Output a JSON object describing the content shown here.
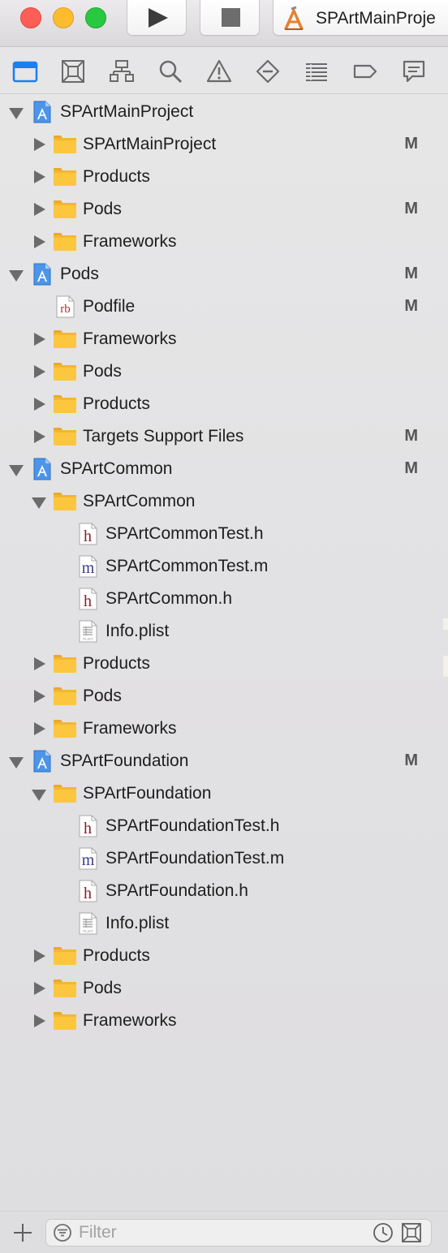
{
  "window": {
    "scheme_label": "SPArtMainProje"
  },
  "toolbar": {
    "run_icon": "play-icon",
    "stop_icon": "stop-icon"
  },
  "navigator_tabs": [
    {
      "name": "project-navigator-tab",
      "icon": "folder-icon",
      "active": true
    },
    {
      "name": "source-control-navigator-tab",
      "icon": "source-control-icon",
      "active": false
    },
    {
      "name": "symbol-navigator-tab",
      "icon": "hierarchy-icon",
      "active": false
    },
    {
      "name": "find-navigator-tab",
      "icon": "magnifier-icon",
      "active": false
    },
    {
      "name": "issue-navigator-tab",
      "icon": "warning-icon",
      "active": false
    },
    {
      "name": "test-navigator-tab",
      "icon": "diamond-icon",
      "active": false
    },
    {
      "name": "debug-navigator-tab",
      "icon": "list-icon",
      "active": false
    },
    {
      "name": "breakpoint-navigator-tab",
      "icon": "tag-icon",
      "active": false
    },
    {
      "name": "report-navigator-tab",
      "icon": "speech-bubble-icon",
      "active": false
    }
  ],
  "tree": [
    {
      "label": "SPArtMainProject",
      "icon": "project",
      "level": 0,
      "state": "expanded",
      "badge": ""
    },
    {
      "label": "SPArtMainProject",
      "icon": "folder",
      "level": 1,
      "state": "collapsed",
      "badge": "M"
    },
    {
      "label": "Products",
      "icon": "folder",
      "level": 1,
      "state": "collapsed",
      "badge": ""
    },
    {
      "label": "Pods",
      "icon": "folder",
      "level": 1,
      "state": "collapsed",
      "badge": "M"
    },
    {
      "label": "Frameworks",
      "icon": "folder",
      "level": 1,
      "state": "collapsed",
      "badge": ""
    },
    {
      "label": "Pods",
      "icon": "project",
      "level": 0,
      "state": "expanded",
      "badge": "M"
    },
    {
      "label": "Podfile",
      "icon": "ruby",
      "level": 1,
      "state": "none",
      "badge": "M"
    },
    {
      "label": "Frameworks",
      "icon": "folder",
      "level": 1,
      "state": "collapsed",
      "badge": ""
    },
    {
      "label": "Pods",
      "icon": "folder",
      "level": 1,
      "state": "collapsed",
      "badge": ""
    },
    {
      "label": "Products",
      "icon": "folder",
      "level": 1,
      "state": "collapsed",
      "badge": ""
    },
    {
      "label": "Targets Support Files",
      "icon": "folder",
      "level": 1,
      "state": "collapsed",
      "badge": "M"
    },
    {
      "label": "SPArtCommon",
      "icon": "project",
      "level": 0,
      "state": "expanded",
      "badge": "M"
    },
    {
      "label": "SPArtCommon",
      "icon": "folder",
      "level": 1,
      "state": "expanded",
      "badge": ""
    },
    {
      "label": "SPArtCommonTest.h",
      "icon": "header",
      "level": 2,
      "state": "none",
      "badge": ""
    },
    {
      "label": "SPArtCommonTest.m",
      "icon": "implementation",
      "level": 2,
      "state": "none",
      "badge": ""
    },
    {
      "label": "SPArtCommon.h",
      "icon": "header",
      "level": 2,
      "state": "none",
      "badge": ""
    },
    {
      "label": "Info.plist",
      "icon": "plist",
      "level": 2,
      "state": "none",
      "badge": ""
    },
    {
      "label": "Products",
      "icon": "folder",
      "level": 1,
      "state": "collapsed",
      "badge": ""
    },
    {
      "label": "Pods",
      "icon": "folder",
      "level": 1,
      "state": "collapsed",
      "badge": ""
    },
    {
      "label": "Frameworks",
      "icon": "folder",
      "level": 1,
      "state": "collapsed",
      "badge": ""
    },
    {
      "label": "SPArtFoundation",
      "icon": "project",
      "level": 0,
      "state": "expanded",
      "badge": "M"
    },
    {
      "label": "SPArtFoundation",
      "icon": "folder",
      "level": 1,
      "state": "expanded",
      "badge": ""
    },
    {
      "label": "SPArtFoundationTest.h",
      "icon": "header",
      "level": 2,
      "state": "none",
      "badge": ""
    },
    {
      "label": "SPArtFoundationTest.m",
      "icon": "implementation",
      "level": 2,
      "state": "none",
      "badge": ""
    },
    {
      "label": "SPArtFoundation.h",
      "icon": "header",
      "level": 2,
      "state": "none",
      "badge": ""
    },
    {
      "label": "Info.plist",
      "icon": "plist",
      "level": 2,
      "state": "none",
      "badge": ""
    },
    {
      "label": "Products",
      "icon": "folder",
      "level": 1,
      "state": "collapsed",
      "badge": ""
    },
    {
      "label": "Pods",
      "icon": "folder",
      "level": 1,
      "state": "collapsed",
      "badge": ""
    },
    {
      "label": "Frameworks",
      "icon": "folder",
      "level": 1,
      "state": "collapsed",
      "badge": ""
    }
  ],
  "filter": {
    "placeholder": "Filter",
    "value": ""
  },
  "colors": {
    "accent": "#1a7ff0",
    "folder": "#fcc73f",
    "badge": "#555555",
    "header_letter": "#8a1f2a",
    "implementation_letter": "#3a3a8c"
  }
}
